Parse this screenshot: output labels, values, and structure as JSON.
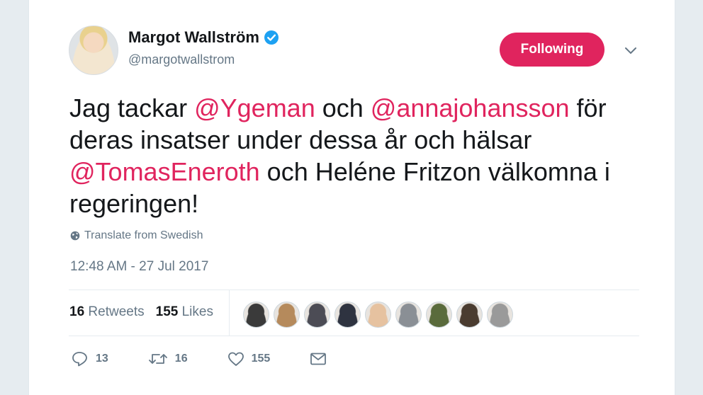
{
  "author": {
    "name": "Margot Wallström",
    "handle": "@margotwallstrom",
    "avatar_icon": "profile-photo",
    "verified_icon": "verified-badge-icon"
  },
  "follow_button": {
    "label": "Following",
    "color": "#e0245e"
  },
  "tweet": {
    "segments": [
      {
        "text": "Jag tackar ",
        "type": "text"
      },
      {
        "text": "@Ygeman",
        "type": "mention"
      },
      {
        "text": " och ",
        "type": "text"
      },
      {
        "text": "@annajohansson",
        "type": "mention"
      },
      {
        "text": " för deras insatser under dessa år och hälsar ",
        "type": "text"
      },
      {
        "text": "@TomasEneroth",
        "type": "mention"
      },
      {
        "text": " och Heléne Fritzon välkomna i regeringen!",
        "type": "text"
      }
    ],
    "translate_label": "Translate from Swedish",
    "timestamp": "12:48 AM - 27 Jul 2017"
  },
  "stats": {
    "retweets_count": "16",
    "retweets_label": "Retweets",
    "likes_count": "155",
    "likes_label": "Likes"
  },
  "likers": [
    {
      "name": "liker-avatar-1",
      "color": "#3a3a3a"
    },
    {
      "name": "liker-avatar-2",
      "color": "#b58a5c"
    },
    {
      "name": "liker-avatar-3",
      "color": "#4c4c55"
    },
    {
      "name": "liker-avatar-4",
      "color": "#2e3340"
    },
    {
      "name": "liker-avatar-5",
      "color": "#e6c2a0"
    },
    {
      "name": "liker-avatar-6",
      "color": "#8a8f95"
    },
    {
      "name": "liker-avatar-7",
      "color": "#5a6b3c"
    },
    {
      "name": "liker-avatar-8",
      "color": "#4a3c30"
    },
    {
      "name": "liker-avatar-9",
      "color": "#9a9a9a"
    }
  ],
  "actions": {
    "reply_count": "13",
    "retweet_count": "16",
    "like_count": "155"
  },
  "colors": {
    "mention": "#e0245e",
    "muted": "#657786",
    "verified": "#1da1f2"
  }
}
